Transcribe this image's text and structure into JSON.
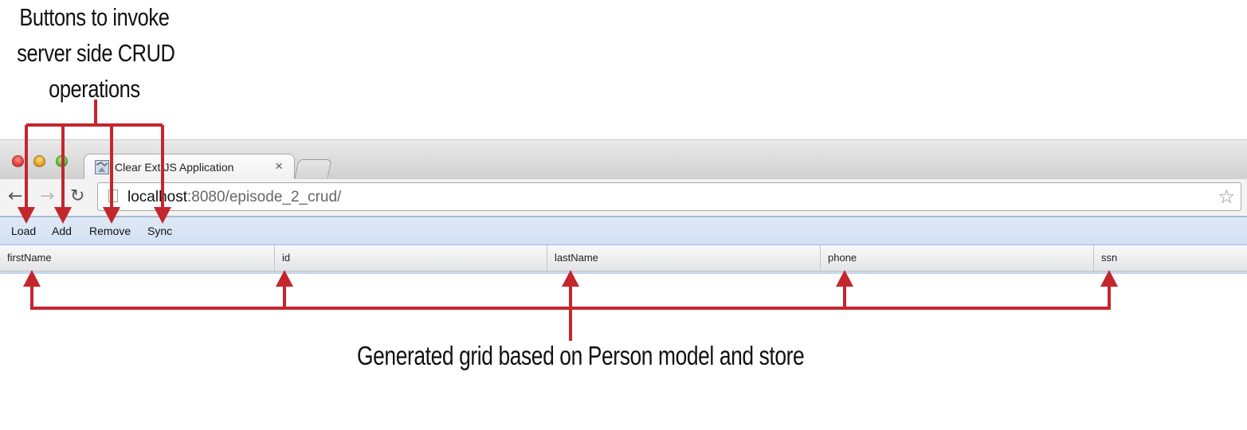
{
  "annotations": {
    "top": [
      "Buttons to invoke",
      "server side CRUD",
      "operations"
    ],
    "bottom": "Generated grid based on Person model and store",
    "arrow_color": "#c4262e"
  },
  "browser": {
    "tab_title": "Clear Ext JS Application",
    "tab_close": "×",
    "url_host": "localhost",
    "url_path": ":8080/episode_2_crud/",
    "icons": {
      "back": "back-arrow-icon",
      "forward": "forward-arrow-icon",
      "reload": "reload-icon",
      "page": "page-icon",
      "star": "star-icon"
    }
  },
  "app": {
    "buttons": [
      "Load",
      "Add",
      "Remove",
      "Sync"
    ],
    "grid": {
      "columns": [
        "firstName",
        "id",
        "lastName",
        "phone",
        "ssn"
      ]
    },
    "colors": {
      "toolbar": "#d3e1f3",
      "toolbar_border": "#99bbe8"
    }
  }
}
